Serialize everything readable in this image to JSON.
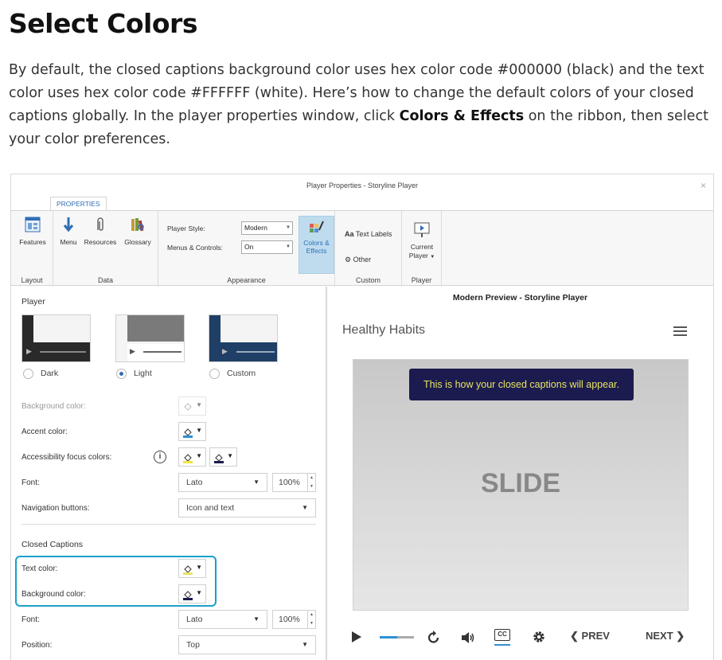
{
  "heading": "Select Colors",
  "intro": {
    "text_before": "By default, the closed captions background color uses hex color code #000000 (black) and the text color uses hex color code #FFFFFF (white). Here’s how to change the default colors of your closed captions globally. In the player properties window, click ",
    "bold": "Colors & Effects",
    "text_after": " on the ribbon, then select your color preferences."
  },
  "window": {
    "title": "Player Properties - Storyline Player",
    "close": "×",
    "tab": "PROPERTIES"
  },
  "ribbon": {
    "layout": {
      "label": "Layout",
      "features": "Features"
    },
    "data": {
      "label": "Data",
      "menu": "Menu",
      "resources": "Resources",
      "glossary": "Glossary"
    },
    "appearance": {
      "label": "Appearance",
      "player_style_label": "Player Style:",
      "player_style_value": "Modern",
      "menus_controls_label": "Menus & Controls:",
      "menus_controls_value": "On",
      "colors_effects": "Colors & Effects"
    },
    "custom": {
      "label": "Custom",
      "text_labels": "Text Labels",
      "text_labels_prefix": "Aa",
      "other": "Other"
    },
    "player": {
      "label": "Player",
      "current_player": "Current Player"
    }
  },
  "left": {
    "player_section": "Player",
    "themes": [
      {
        "label": "Dark",
        "selected": false
      },
      {
        "label": "Light",
        "selected": true
      },
      {
        "label": "Custom",
        "selected": false
      }
    ],
    "background_color": "Background color:",
    "accent_color": "Accent color:",
    "accessibility_focus": "Accessibility focus colors:",
    "info": "i",
    "font_label": "Font:",
    "font_value": "Lato",
    "font_size": "100%",
    "nav_buttons_label": "Navigation buttons:",
    "nav_buttons_value": "Icon and text",
    "cc_section": "Closed Captions",
    "text_color": "Text color:",
    "cc_background_color": "Background color:",
    "cc_font_label": "Font:",
    "cc_font_value": "Lato",
    "cc_font_size": "100%",
    "position_label": "Position:",
    "position_value": "Top"
  },
  "preview": {
    "title": "Modern Preview - Storyline Player",
    "course_title": "Healthy Habits",
    "caption": "This is how your closed captions will appear.",
    "slide_text": "SLIDE",
    "cc": "CC",
    "prev": "PREV",
    "next": "NEXT"
  },
  "colors": {
    "caption_bg": "#1b1b4f",
    "caption_text": "#e8e463",
    "highlight": "#1aa0c8",
    "accent": "#2f6fb5"
  }
}
